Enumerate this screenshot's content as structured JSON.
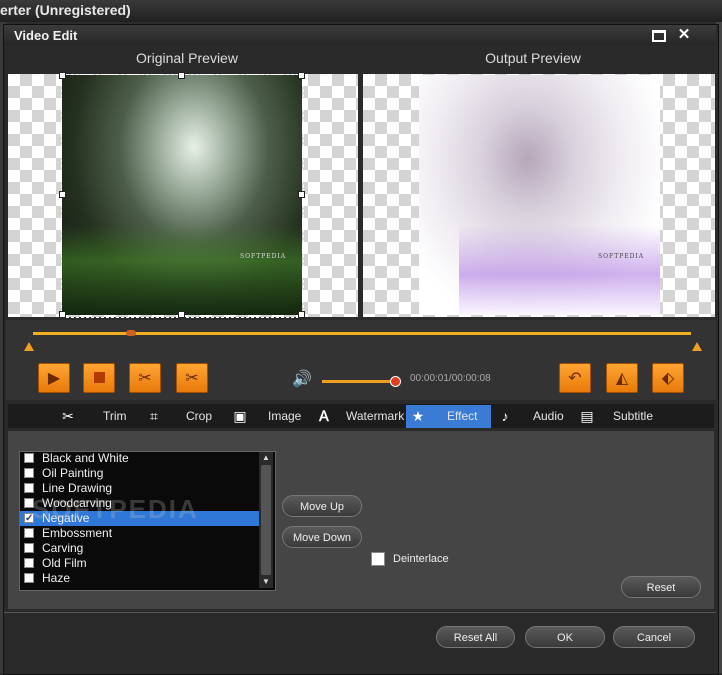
{
  "app": {
    "title": "erter (Unregistered)"
  },
  "dialog": {
    "title": "Video Edit",
    "preview": {
      "original_label": "Original Preview",
      "output_label": "Output Preview",
      "watermark_text": "SOFTPEDIA"
    },
    "playback": {
      "time": "00:00:01/00:00:08",
      "volume_percent": 95,
      "timeline_position_percent": 15
    },
    "tabs": [
      {
        "label": "Trim",
        "icon": "scissors-icon"
      },
      {
        "label": "Crop",
        "icon": "crop-icon"
      },
      {
        "label": "Image",
        "icon": "image-icon"
      },
      {
        "label": "Watermark",
        "icon": "watermark-icon"
      },
      {
        "label": "Effect",
        "icon": "star-icon",
        "active": true
      },
      {
        "label": "Audio",
        "icon": "music-note-icon"
      },
      {
        "label": "Subtitle",
        "icon": "subtitle-icon"
      }
    ],
    "effects": [
      {
        "label": "Black and White",
        "checked": false
      },
      {
        "label": "Oil Painting",
        "checked": false
      },
      {
        "label": "Line Drawing",
        "checked": false
      },
      {
        "label": "Woodcarving",
        "checked": false
      },
      {
        "label": "Negative",
        "checked": true,
        "selected": true
      },
      {
        "label": "Embossment",
        "checked": false
      },
      {
        "label": "Carving",
        "checked": false
      },
      {
        "label": "Old Film",
        "checked": false
      },
      {
        "label": "Haze",
        "checked": false
      }
    ],
    "list_watermark": "SOFTPEDIA",
    "buttons": {
      "move_up": "Move Up",
      "move_down": "Move Down",
      "reset": "Reset",
      "reset_all": "Reset All",
      "ok": "OK",
      "cancel": "Cancel"
    },
    "deinterlace_label": "Deinterlace",
    "deinterlace_checked": false
  },
  "colors": {
    "accent_orange": "#f0a020",
    "tab_active_blue": "#3a7bd5",
    "selection_blue": "#2f78d8"
  }
}
